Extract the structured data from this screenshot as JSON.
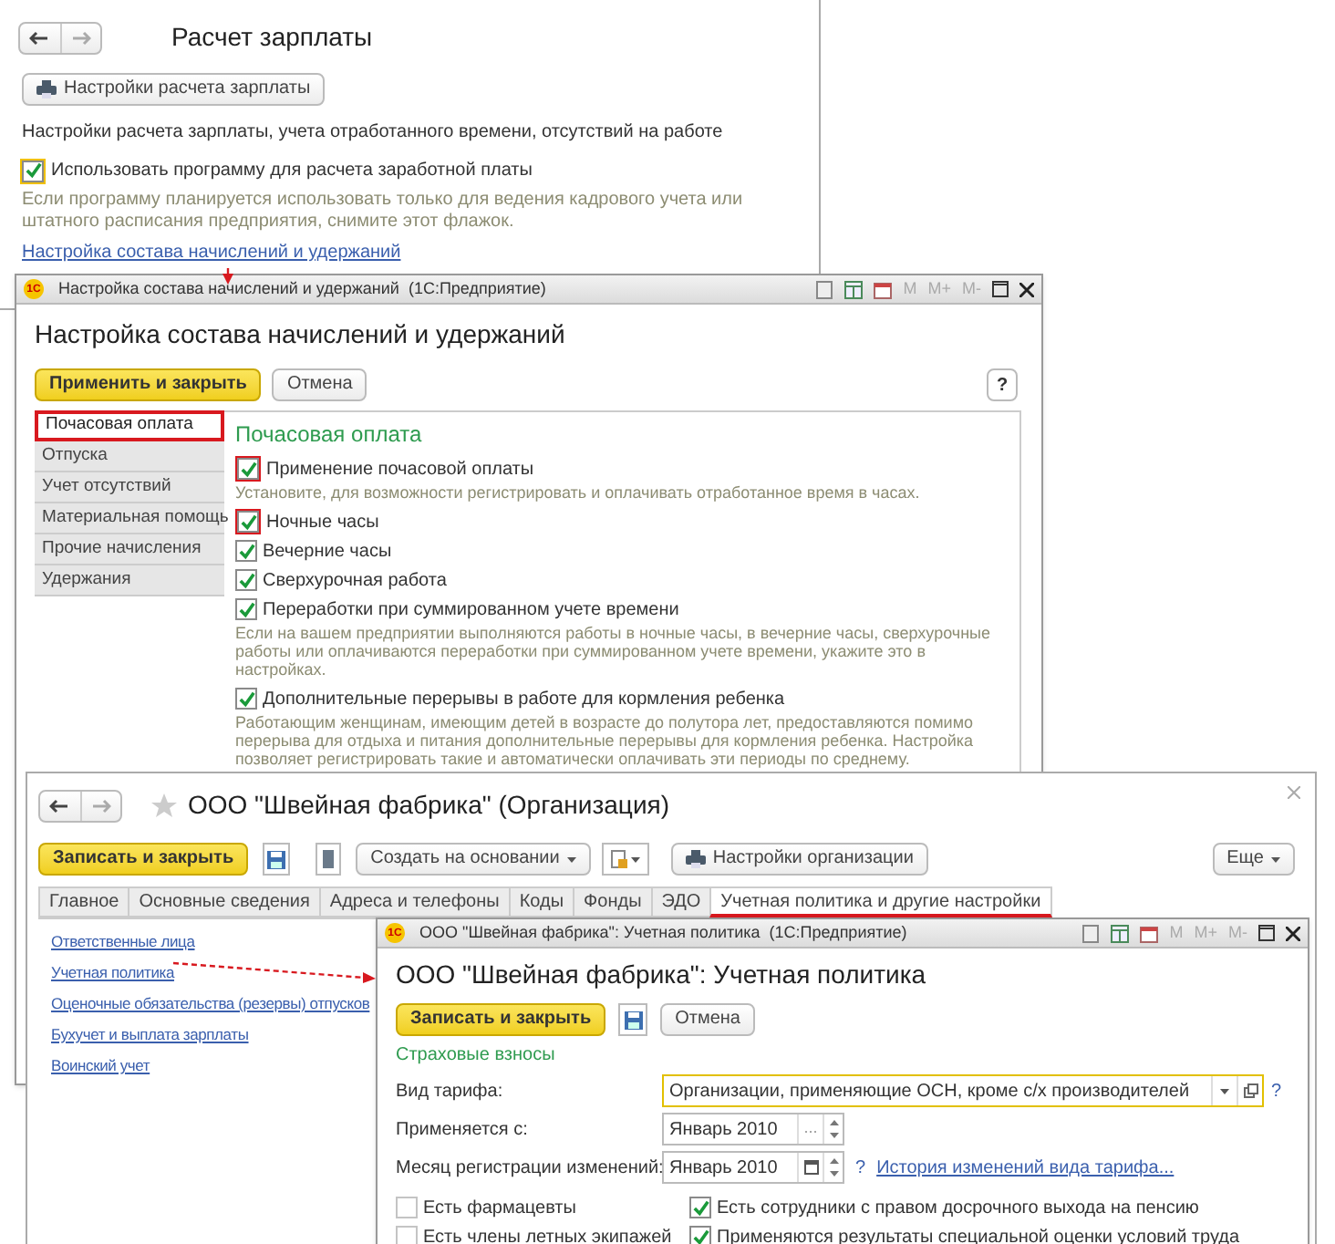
{
  "salary_window": {
    "title": "Расчет зарплаты",
    "settings_button": "Настройки расчета зарплаты",
    "description": "Настройки расчета зарплаты, учета отработанного времени, отсутствий на работе",
    "use_program": {
      "label": "Использовать программу для расчета заработной платы",
      "checked": true,
      "focused": true
    },
    "hint": "Если программу планируется использовать только для ведения кадрового учета или штатного расписания предприятия, снимите этот флажок.",
    "link": "Настройка состава начислений и удержаний"
  },
  "accruals_dialog": {
    "logo": "1С",
    "window_title": "Настройка состава начислений и удержаний  (1С:Предприятие)",
    "memory_buttons": [
      "M",
      "M+",
      "M-"
    ],
    "title": "Настройка состава начислений и удержаний",
    "apply_button": "Применить и закрыть",
    "cancel_button": "Отмена",
    "help_button": "?",
    "sections": [
      {
        "label": "Почасовая оплата",
        "selected": true
      },
      {
        "label": "Отпуска",
        "selected": false
      },
      {
        "label": "Учет отсутствий",
        "selected": false
      },
      {
        "label": "Материальная помощь",
        "selected": false
      },
      {
        "label": "Прочие начисления",
        "selected": false
      },
      {
        "label": "Удержания",
        "selected": false
      }
    ],
    "section_title": "Почасовая оплата",
    "options": [
      {
        "kind": "checkbox",
        "label": "Применение почасовой оплаты",
        "checked": true,
        "highlighted": true
      },
      {
        "kind": "hint",
        "text": "Установите, для возможности регистрировать и оплачивать отработанное время в часах."
      },
      {
        "kind": "checkbox",
        "label": "Ночные часы",
        "checked": true,
        "highlighted": true
      },
      {
        "kind": "checkbox",
        "label": "Вечерние часы",
        "checked": true,
        "highlighted": false
      },
      {
        "kind": "checkbox",
        "label": "Сверхурочная работа",
        "checked": true,
        "highlighted": false
      },
      {
        "kind": "checkbox",
        "label": "Переработки при суммированном учете времени",
        "checked": true,
        "highlighted": false
      },
      {
        "kind": "hint",
        "text": "Если на вашем предприятии выполняются работы в ночные часы, в вечерние часы, сверхурочные работы или оплачиваются переработки при суммированном учете времени, укажите это в настройках."
      },
      {
        "kind": "checkbox",
        "label": "Дополнительные перерывы в работе для кормления ребенка",
        "checked": true,
        "highlighted": false
      },
      {
        "kind": "hint",
        "text": "Работающим женщинам, имеющим детей в возрасте до полутора лет, предоставляются помимо перерыва для отдыха и питания дополнительные перерывы для кормления ребенка. Настройка позволяет регистрировать такие и автоматически оплачивать эти периоды по среднему."
      }
    ]
  },
  "organization_form": {
    "title": "ООО \"Швейная фабрика\" (Организация)",
    "save_close_button": "Записать и закрыть",
    "create_based_on_button": "Создать на основании",
    "organization_settings_button": "Настройки организации",
    "more_button": "Еще",
    "tabs": [
      {
        "label": "Главное",
        "selected": false
      },
      {
        "label": "Основные сведения",
        "selected": false
      },
      {
        "label": "Адреса и телефоны",
        "selected": false
      },
      {
        "label": "Коды",
        "selected": false
      },
      {
        "label": "Фонды",
        "selected": false
      },
      {
        "label": "ЭДО",
        "selected": false
      },
      {
        "label": "Учетная политика и другие настройки",
        "selected": true
      }
    ],
    "links": [
      "Ответственные лица",
      "Учетная политика",
      "Оценочные обязательства (резервы) отпусков",
      "Бухучет и выплата зарплаты",
      "Воинский учет"
    ]
  },
  "accounting_policy_dialog": {
    "logo": "1С",
    "window_title": "ООО \"Швейная фабрика\": Учетная политика  (1С:Предприятие)",
    "memory_buttons": [
      "M",
      "M+",
      "M-"
    ],
    "title": "ООО \"Швейная фабрика\": Учетная политика",
    "save_close_button": "Записать и закрыть",
    "cancel_button": "Отмена",
    "section_title": "Страховые взносы",
    "fields": [
      {
        "kind": "combo",
        "label": "Вид тарифа:",
        "value": "Организации, применяющие ОСН, кроме с/х производителей",
        "help": "?"
      },
      {
        "kind": "month",
        "label": "Применяется с:",
        "value": "Январь 2010",
        "select_button": "..."
      },
      {
        "kind": "calendar",
        "label": "Месяц регистрации изменений:",
        "value": "Январь 2010",
        "help": "?",
        "link": "История изменений вида тарифа..."
      }
    ],
    "options": [
      {
        "label": "Есть фармацевты",
        "checked": false
      },
      {
        "label": "Есть сотрудники с правом досрочного выхода на пенсию",
        "checked": true
      },
      {
        "label": "Есть члены летных экипажей",
        "checked": false
      },
      {
        "label": "Применяются результаты специальной оценки условий труда",
        "checked": true
      }
    ]
  }
}
